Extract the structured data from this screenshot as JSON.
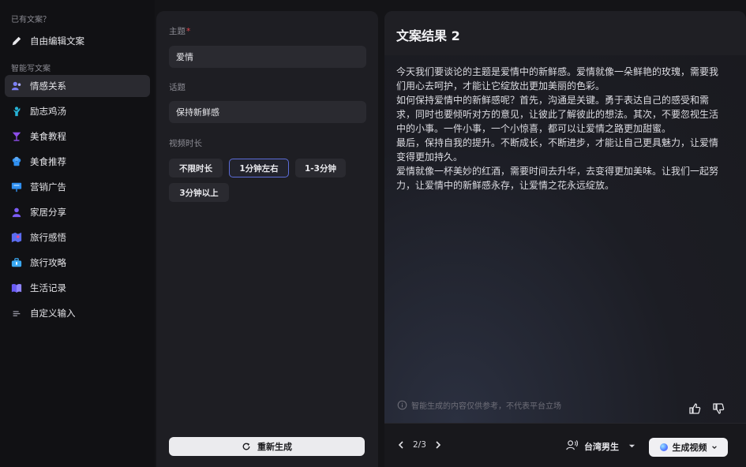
{
  "sidebar": {
    "section_existing": "已有文案？",
    "free_edit": "自由编辑文案",
    "section_ai": "智能写文案",
    "items": [
      {
        "label": "情感关系",
        "color": "#7b7ff5"
      },
      {
        "label": "励志鸡汤",
        "color": "#27b3d6"
      },
      {
        "label": "美食教程",
        "color": "#8d4de8"
      },
      {
        "label": "美食推荐",
        "color": "#2f8ff0"
      },
      {
        "label": "营销广告",
        "color": "#2f8ff0"
      },
      {
        "label": "家居分享",
        "color": "#7b5cf5"
      },
      {
        "label": "旅行感悟",
        "color": "#5b6cf0"
      },
      {
        "label": "旅行攻略",
        "color": "#3aa8f2"
      },
      {
        "label": "生活记录",
        "color": "#6a5cf5"
      },
      {
        "label": "自定义输入",
        "color": "#9b9ba6"
      }
    ]
  },
  "form": {
    "theme_label": "主题",
    "theme_required": "*",
    "theme_value": "爱情",
    "topic_label": "话题",
    "topic_value": "保持新鲜感",
    "duration_label": "视频时长",
    "durations": [
      "不限时长",
      "1分钟左右",
      "1-3分钟",
      "3分钟以上"
    ],
    "regenerate": "重新生成"
  },
  "result": {
    "title": "文案结果 2",
    "paragraphs": [
      "今天我们要谈论的主题是爱情中的新鲜感。爱情就像一朵鲜艳的玫瑰，需要我们用心去呵护，才能让它绽放出更加美丽的色彩。",
      "如何保持爱情中的新鲜感呢？首先，沟通是关键。勇于表达自己的感受和需求，同时也要倾听对方的意见，让彼此了解彼此的想法。其次，不要忽视生活中的小事。一件小事，一个小惊喜，都可以让爱情之路更加甜蜜。",
      "最后，保持自我的提升。不断成长，不断进步，才能让自己更具魅力，让爱情变得更加持久。",
      "爱情就像一杯美妙的红酒，需要时间去升华，去变得更加美味。让我们一起努力，让爱情中的新鲜感永存，让爱情之花永远绽放。"
    ],
    "disclaimer": "智能生成的内容仅供参考，不代表平台立场",
    "pager": "2/3",
    "voice": "台湾男生",
    "generate_video": "生成视频"
  }
}
